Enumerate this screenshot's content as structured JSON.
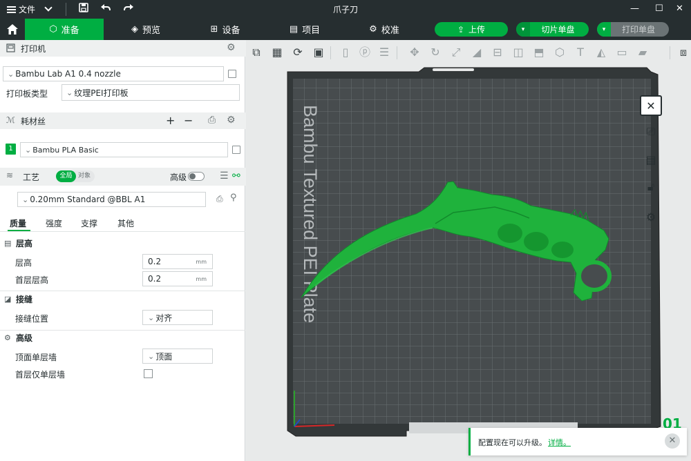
{
  "window": {
    "file_menu": "文件",
    "title": "爪子刀",
    "minimize": "—",
    "maximize": "☐",
    "close": "✕"
  },
  "tabs": [
    {
      "label": "准备",
      "icon": "cube-icon",
      "active": true
    },
    {
      "label": "预览",
      "icon": "layers-icon"
    },
    {
      "label": "设备",
      "icon": "device-icon"
    },
    {
      "label": "项目",
      "icon": "project-icon"
    },
    {
      "label": "校准",
      "icon": "calibrate-icon"
    }
  ],
  "actions": {
    "upload": "上传",
    "slice": "切片单盘",
    "print": "打印单盘"
  },
  "printer": {
    "section_label": "打印机",
    "preset": "Bambu Lab A1 0.4 nozzle",
    "plate_type_label": "打印板类型",
    "plate_type_value": "纹理PEI打印板"
  },
  "filament": {
    "section_label": "耗材丝",
    "slot_number": "1",
    "preset": "Bambu PLA Basic",
    "slot_color": "#00ae42"
  },
  "process": {
    "section_label": "工艺",
    "toggle_global": "全局",
    "toggle_object": "对象",
    "advanced_label": "高级",
    "preset": "0.20mm Standard @BBL A1",
    "subtabs": [
      "质量",
      "强度",
      "支撑",
      "其他"
    ],
    "groups": {
      "layer_height": {
        "title": "层高",
        "rows": [
          {
            "label": "层高",
            "value": "0.2",
            "unit": "mm"
          },
          {
            "label": "首层层高",
            "value": "0.2",
            "unit": "mm"
          }
        ]
      },
      "seam": {
        "title": "接缝",
        "rows": [
          {
            "label": "接缝位置",
            "value": "对齐"
          }
        ]
      },
      "advanced": {
        "title": "高级",
        "rows": [
          {
            "label": "顶面单层墙",
            "value": "顶面"
          },
          {
            "label": "首层仅单层墙",
            "checked": false
          }
        ]
      }
    }
  },
  "viewport": {
    "plate_text": "Bambu Textured PEI Plate",
    "plate_number": "01",
    "model_color": "#1fb23c"
  },
  "notification": {
    "message": "配置现在可以升级。",
    "link": "详情。"
  }
}
